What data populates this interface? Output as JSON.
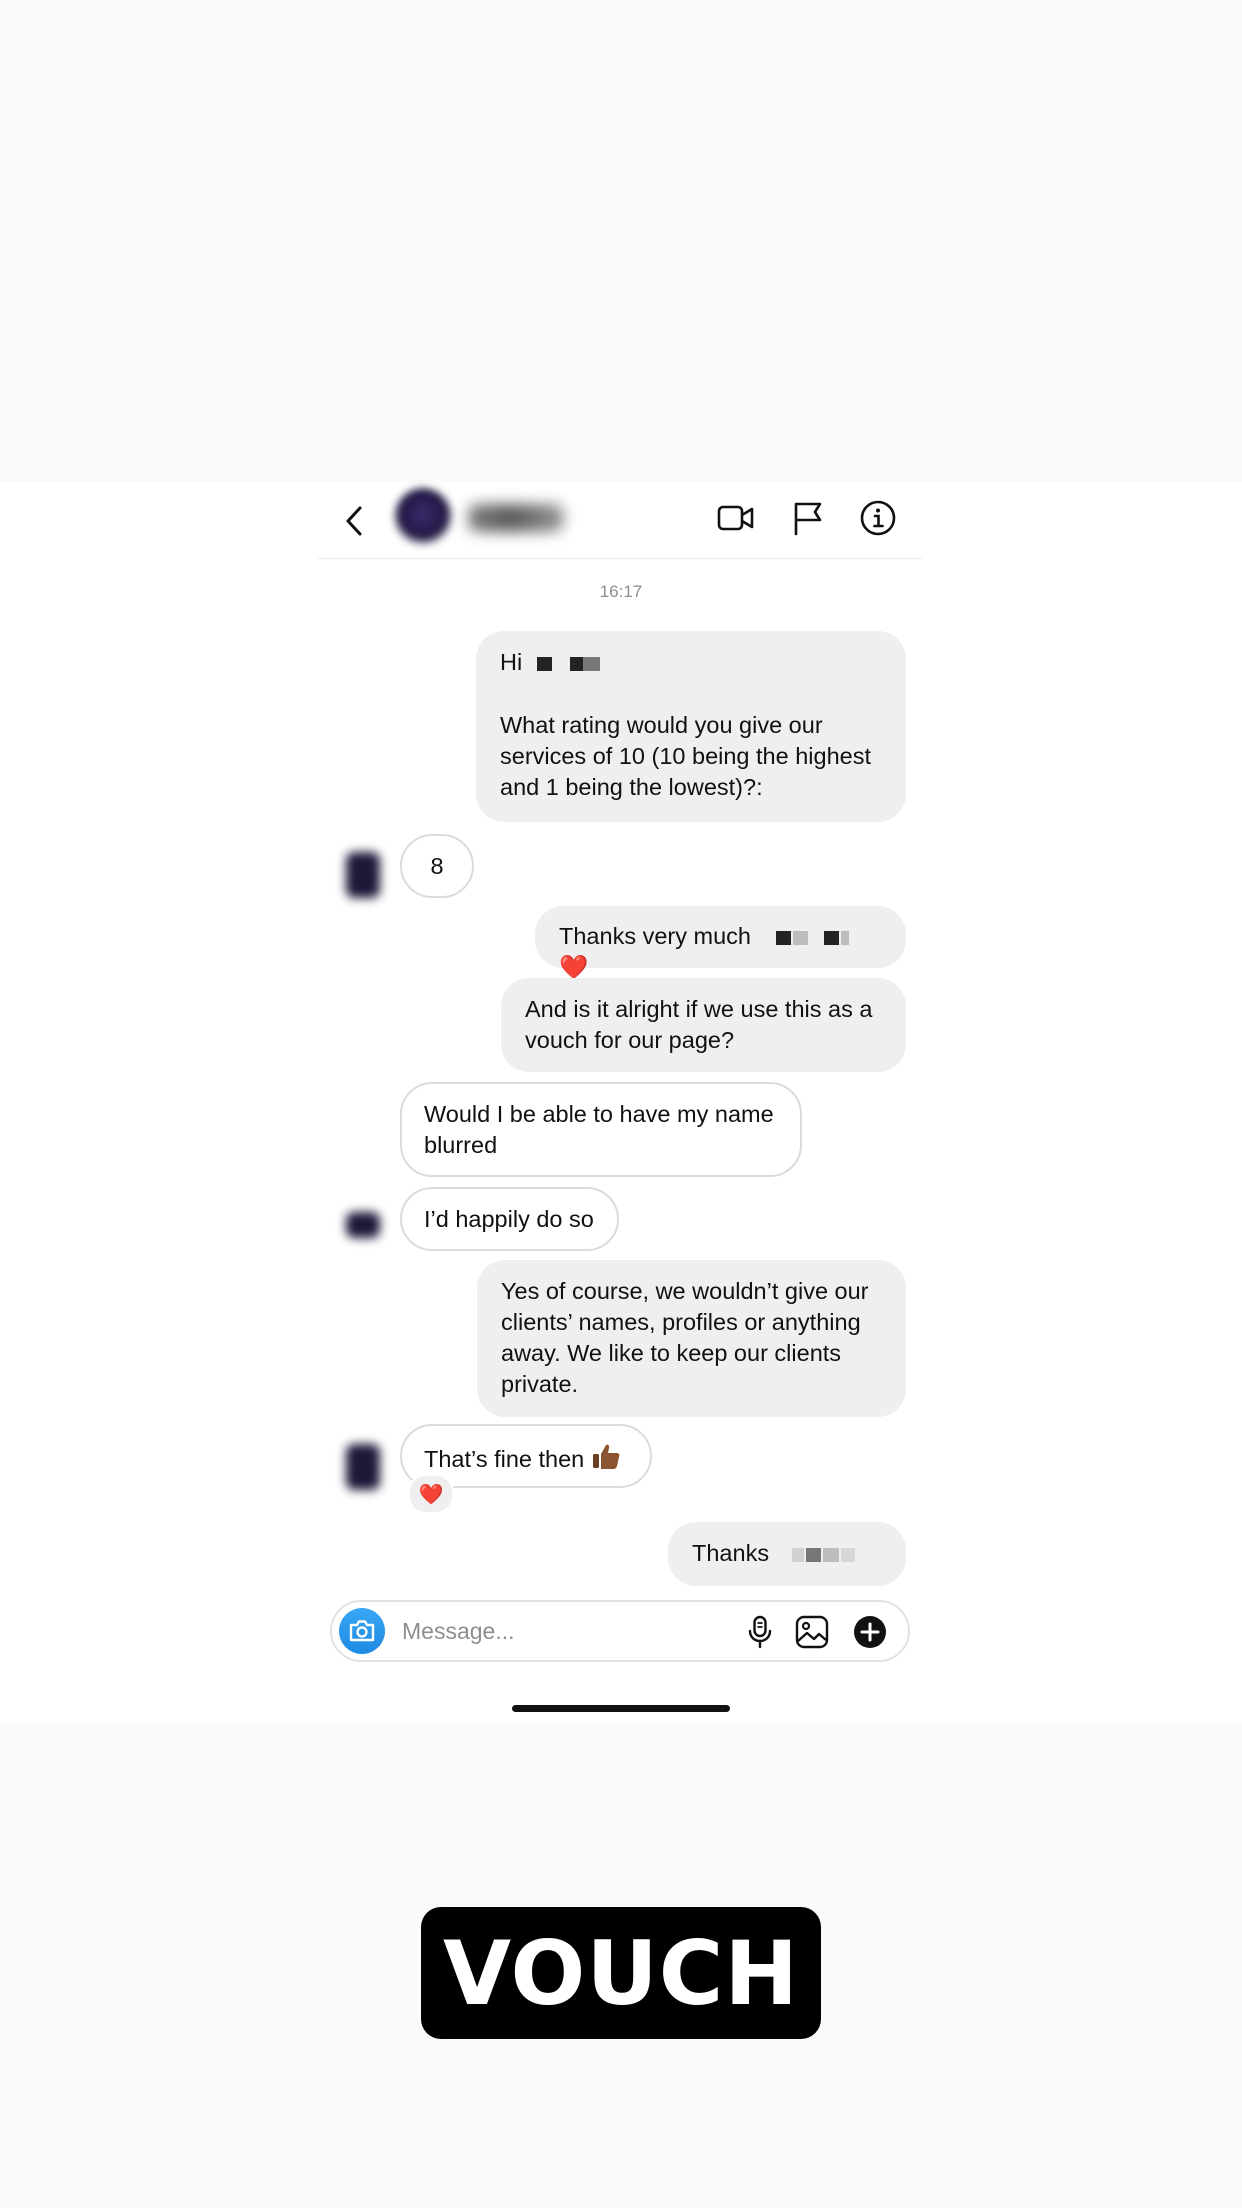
{
  "chat": {
    "timestamp": "16:17",
    "composer_placeholder": "Message..."
  },
  "messages": {
    "m1_greeting": "Hi",
    "m1_body": "What rating would you give our services of 10 (10 being the highest and 1 being the lowest)?:",
    "m2": "8",
    "m3": "Thanks very much",
    "m3_emoji": "❤️",
    "m4": "And is it alright if we use this as a vouch for our page?",
    "m5": "Would I be able to have my name blurred",
    "m6": "I’d happily do so",
    "m7": "Yes of course, we wouldn’t give our clients’ names, profiles or anything away. We like to keep our clients private.",
    "m8": "That’s fine then",
    "m8_reaction": "❤️",
    "m9": "Thanks"
  },
  "overlay": {
    "label": "VOUCH"
  },
  "colors": {
    "outgoing_bubble": "#efefef",
    "incoming_border": "#dbdbdb",
    "camera_button": "#1d8ae3",
    "heart": "#e0245e",
    "label_bg": "#000000"
  },
  "icons": [
    "chevron-left-icon",
    "video-call-icon",
    "flag-icon",
    "info-icon",
    "camera-icon",
    "mic-icon",
    "gallery-icon",
    "plus-icon",
    "heart-icon",
    "thumbs-up-icon"
  ]
}
